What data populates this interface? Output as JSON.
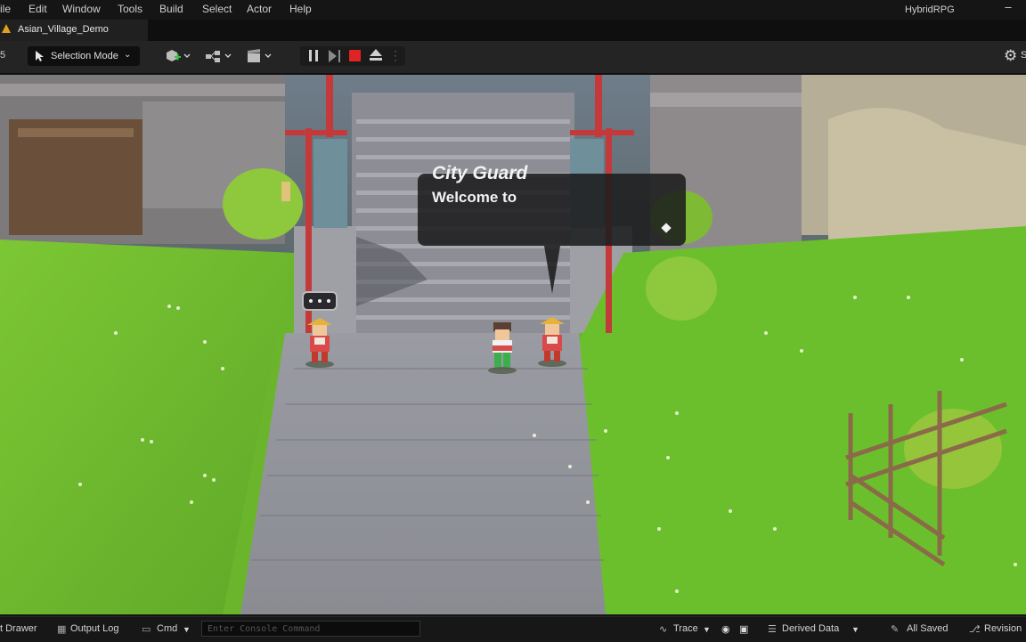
{
  "menu": {
    "items": [
      "ile",
      "Edit",
      "Window",
      "Tools",
      "Build",
      "Select",
      "Actor",
      "Help"
    ],
    "app_title": "HybridRPG",
    "minimize": "–"
  },
  "tab": {
    "label": "Asian_Village_Demo"
  },
  "toolbar": {
    "left_edge": "5",
    "selection_mode": "Selection Mode",
    "settings_label": "S"
  },
  "dialog": {
    "speaker": "City Guard",
    "line": "Welcome to"
  },
  "statusbar": {
    "content_drawer": "t Drawer",
    "output_log": "Output Log",
    "cmd": "Cmd",
    "console_placeholder": "Enter Console Command",
    "trace": "Trace",
    "derived_data": "Derived Data",
    "all_saved": "All Saved",
    "revision": "Revision"
  },
  "colors": {
    "grass": "#6ab52c",
    "stone_path": "#8f9096",
    "pole_red": "#c43a3a",
    "stop_red": "#e02424",
    "tab_accent": "#e0a020"
  },
  "icons": [
    "select-arrow-icon",
    "add-actor-icon",
    "blueprint-icon",
    "cinematics-icon",
    "pause-icon",
    "step-icon",
    "stop-icon",
    "eject-icon",
    "gear-icon",
    "trace-icon",
    "derived-data-icon",
    "save-icon",
    "revision-icon"
  ]
}
